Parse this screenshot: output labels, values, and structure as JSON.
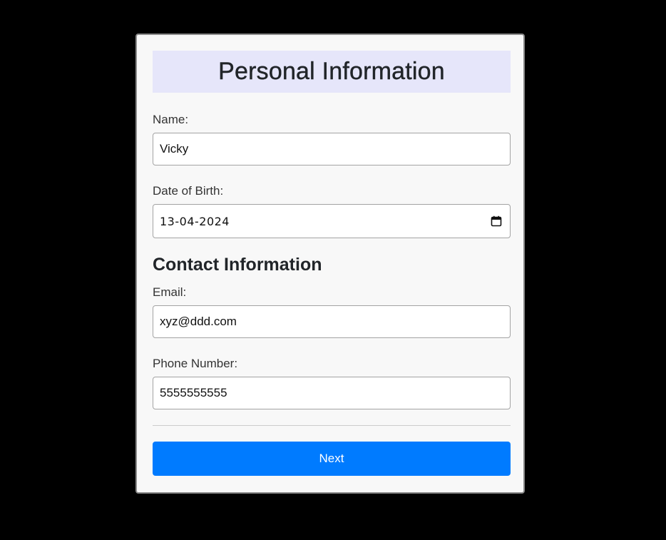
{
  "form": {
    "title": "Personal Information",
    "name": {
      "label": "Name:",
      "value": "Vicky"
    },
    "dob": {
      "label": "Date of Birth:",
      "value": "13-04-2024",
      "icon": "calendar-icon"
    },
    "contact": {
      "heading": "Contact Information",
      "email": {
        "label": "Email:",
        "value": "xyz@ddd.com"
      },
      "phone": {
        "label": "Phone Number:",
        "value": "5555555555"
      }
    },
    "next_label": "Next"
  },
  "colors": {
    "page_background": "#000000",
    "card_background": "#f8f8f8",
    "title_background": "#e6e6fa",
    "primary_button": "#007bff",
    "button_text": "#ffffff"
  }
}
